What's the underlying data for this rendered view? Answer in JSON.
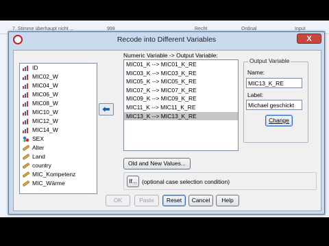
{
  "background": {
    "row_text": [
      "7. Stimme überhaupt nicht ...",
      "999",
      "Recht",
      "Ordinal",
      "Input"
    ]
  },
  "dialog": {
    "title": "Recode into Different Variables",
    "close_label": "X"
  },
  "source_list": {
    "items": [
      {
        "label": "ID",
        "icon": "scale-variable-icon"
      },
      {
        "label": "MIC02_W",
        "icon": "scale-variable-icon"
      },
      {
        "label": "MIC04_W",
        "icon": "scale-variable-icon"
      },
      {
        "label": "MIC06_W",
        "icon": "scale-variable-icon"
      },
      {
        "label": "MIC08_W",
        "icon": "scale-variable-icon"
      },
      {
        "label": "MIC10_W",
        "icon": "scale-variable-icon"
      },
      {
        "label": "MIC12_W",
        "icon": "scale-variable-icon"
      },
      {
        "label": "MIC14_W",
        "icon": "scale-variable-icon"
      },
      {
        "label": "SEX",
        "icon": "nominal-variable-icon"
      },
      {
        "label": "Alter",
        "icon": "ruler-variable-icon"
      },
      {
        "label": "Land",
        "icon": "ruler-variable-icon"
      },
      {
        "label": "country",
        "icon": "ruler-variable-icon"
      },
      {
        "label": "MIC_Kompetenz",
        "icon": "ruler-variable-icon"
      },
      {
        "label": "MIC_Wärme",
        "icon": "ruler-variable-icon"
      }
    ]
  },
  "mapping": {
    "header": "Numeric Variable -> Output Variable:",
    "items": [
      "MIC01_K --> MIC01_K_RE",
      "MIC03_K --> MIC03_K_RE",
      "MIC05_K --> MIC05_K_RE",
      "MIC07_K --> MIC07_K_RE",
      "MIC09_K --> MIC09_K_RE",
      "MIC11_K --> MIC11_K_RE",
      "MIC13_K --> MIC13_K_RE"
    ],
    "selected_index": 6
  },
  "output_variable": {
    "legend": "Output Variable",
    "name_label": "Name:",
    "name_value": "MIC13_K_RE",
    "label_label": "Label:",
    "label_value": "Michael geschickt",
    "change_button": "Change"
  },
  "old_new_button": "Old and New Values...",
  "if_button": "If...",
  "if_caption": "(optional case selection condition)",
  "footer": {
    "ok": "OK",
    "paste": "Paste",
    "reset": "Reset",
    "cancel": "Cancel",
    "help": "Help"
  },
  "colors": {
    "dialog_frame": "#c9d9ee",
    "close_red": "#c8463c",
    "selected_row": "#c6c6c6",
    "arrow_blue": "#1a5aa0"
  }
}
